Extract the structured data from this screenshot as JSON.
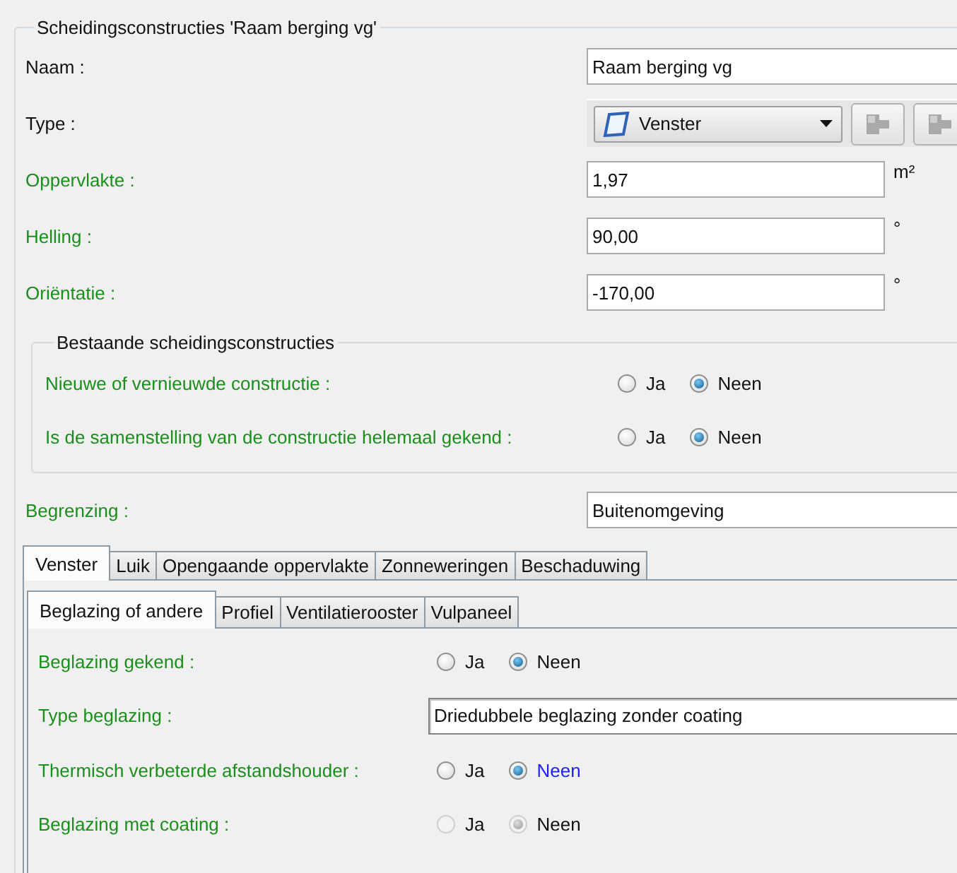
{
  "group_title": "Scheidingsconstructies 'Raam berging vg'",
  "fields": [
    {
      "kind": "text",
      "label": "Naam :",
      "value": "Raam berging vg",
      "emphasized": false
    },
    {
      "kind": "type",
      "label": "Type :",
      "value": "Venster",
      "emphasized": false
    },
    {
      "kind": "number",
      "label": "Oppervlakte :",
      "value": "1,97",
      "unit": "m²",
      "emphasized": true
    },
    {
      "kind": "number",
      "label": "Helling :",
      "value": "90,00",
      "unit": "°",
      "emphasized": true
    },
    {
      "kind": "number",
      "label": "Oriëntatie :",
      "value": "-170,00",
      "unit": "°",
      "emphasized": true
    }
  ],
  "existing": {
    "title": "Bestaande scheidingsconstructies",
    "questions": [
      {
        "label": "Nieuwe of vernieuwde constructie :",
        "options": [
          {
            "label": "Ja",
            "selected": false
          },
          {
            "label": "Neen",
            "selected": true
          }
        ]
      },
      {
        "label": "Is de samenstelling van de constructie helemaal gekend :",
        "options": [
          {
            "label": "Ja",
            "selected": false
          },
          {
            "label": "Neen",
            "selected": true
          }
        ]
      }
    ]
  },
  "boundary": {
    "label": "Begrenzing  :",
    "value": "Buitenomgeving"
  },
  "tabs": [
    {
      "label": "Venster",
      "selected": true
    },
    {
      "label": "Luik",
      "selected": false
    },
    {
      "label": "Opengaande oppervlakte",
      "selected": false
    },
    {
      "label": "Zonneweringen",
      "selected": false
    },
    {
      "label": "Beschaduwing",
      "selected": false
    }
  ],
  "subtabs": [
    {
      "label": "Beglazing of andere",
      "selected": true
    },
    {
      "label": "Profiel",
      "selected": false
    },
    {
      "label": "Ventilatierooster",
      "selected": false
    },
    {
      "label": "Vulpaneel",
      "selected": false
    }
  ],
  "content_rows": [
    {
      "kind": "radio",
      "label": "Beglazing gekend :",
      "disabled": false,
      "options": [
        {
          "label": "Ja",
          "selected": false,
          "focused": false
        },
        {
          "label": "Neen",
          "selected": true,
          "focused": false
        }
      ]
    },
    {
      "kind": "select",
      "label": "Type beglazing :",
      "value": "Driedubbele beglazing zonder coating"
    },
    {
      "kind": "radio",
      "label": "Thermisch verbeterde afstandshouder :",
      "disabled": false,
      "options": [
        {
          "label": "Ja",
          "selected": false,
          "focused": false
        },
        {
          "label": "Neen",
          "selected": true,
          "focused": true
        }
      ]
    },
    {
      "kind": "radio",
      "label": "Beglazing met coating :",
      "disabled": true,
      "options": [
        {
          "label": "Ja",
          "selected": false,
          "focused": false
        },
        {
          "label": "Neen",
          "selected": true,
          "focused": false
        }
      ]
    }
  ]
}
